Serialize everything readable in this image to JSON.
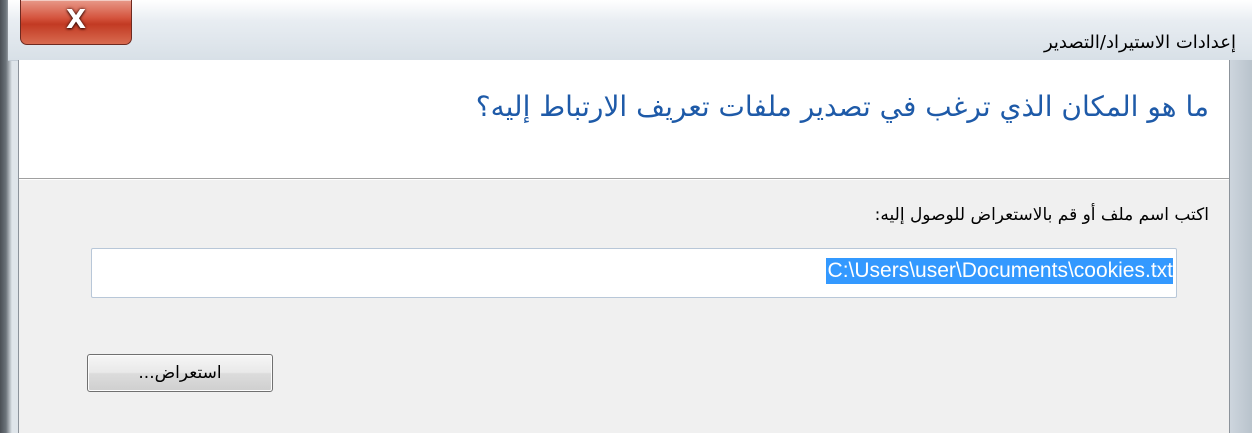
{
  "window": {
    "title": "إعدادات الاستيراد/التصدير",
    "close_icon": "close-icon",
    "close_glyph": "X"
  },
  "dialog": {
    "heading": "ما هو المكان الذي ترغب في تصدير ملفات تعريف الارتباط إليه؟",
    "prompt_label": "اكتب اسم ملف أو قم بالاستعراض للوصول إليه:",
    "file_path": "C:\\Users\\user\\Documents\\cookies.txt",
    "browse_label": "استعراض..."
  },
  "colors": {
    "heading": "#1e5aa8",
    "selection": "#3399ff",
    "close_button": "#c23a23"
  }
}
